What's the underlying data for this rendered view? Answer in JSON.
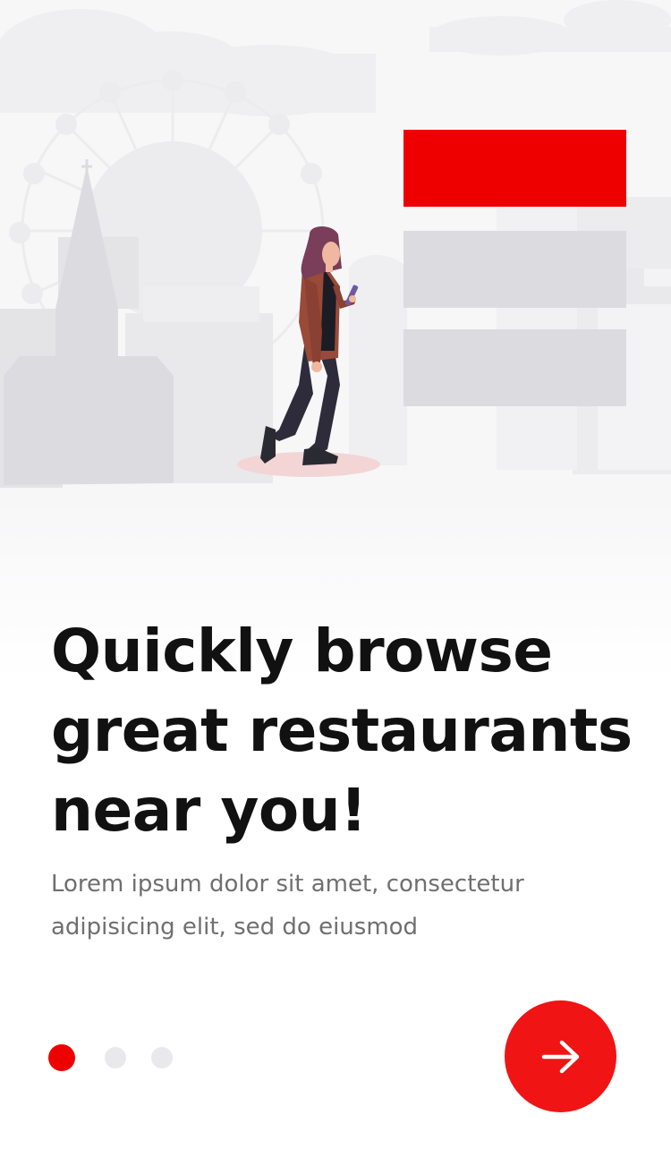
{
  "onboarding": {
    "headline_lines": [
      "Quickly browse",
      "great restaurants",
      "near you!"
    ],
    "subtitle_lines": [
      "Lorem ipsum dolor sit amet, consectetur",
      "adipisicing elit,  sed do eiusmod"
    ],
    "page_indicator": {
      "total": 3,
      "current": 1
    },
    "next_icon": "arrow-right-icon"
  },
  "colors": {
    "accent": "#ee0000",
    "accent_button": "#f01414",
    "headline": "#111111",
    "subtitle": "#6f6f6f",
    "inactive_dot": "#e9e9ec",
    "illustration_gray": "#dcdce0",
    "background": "#ffffff"
  }
}
